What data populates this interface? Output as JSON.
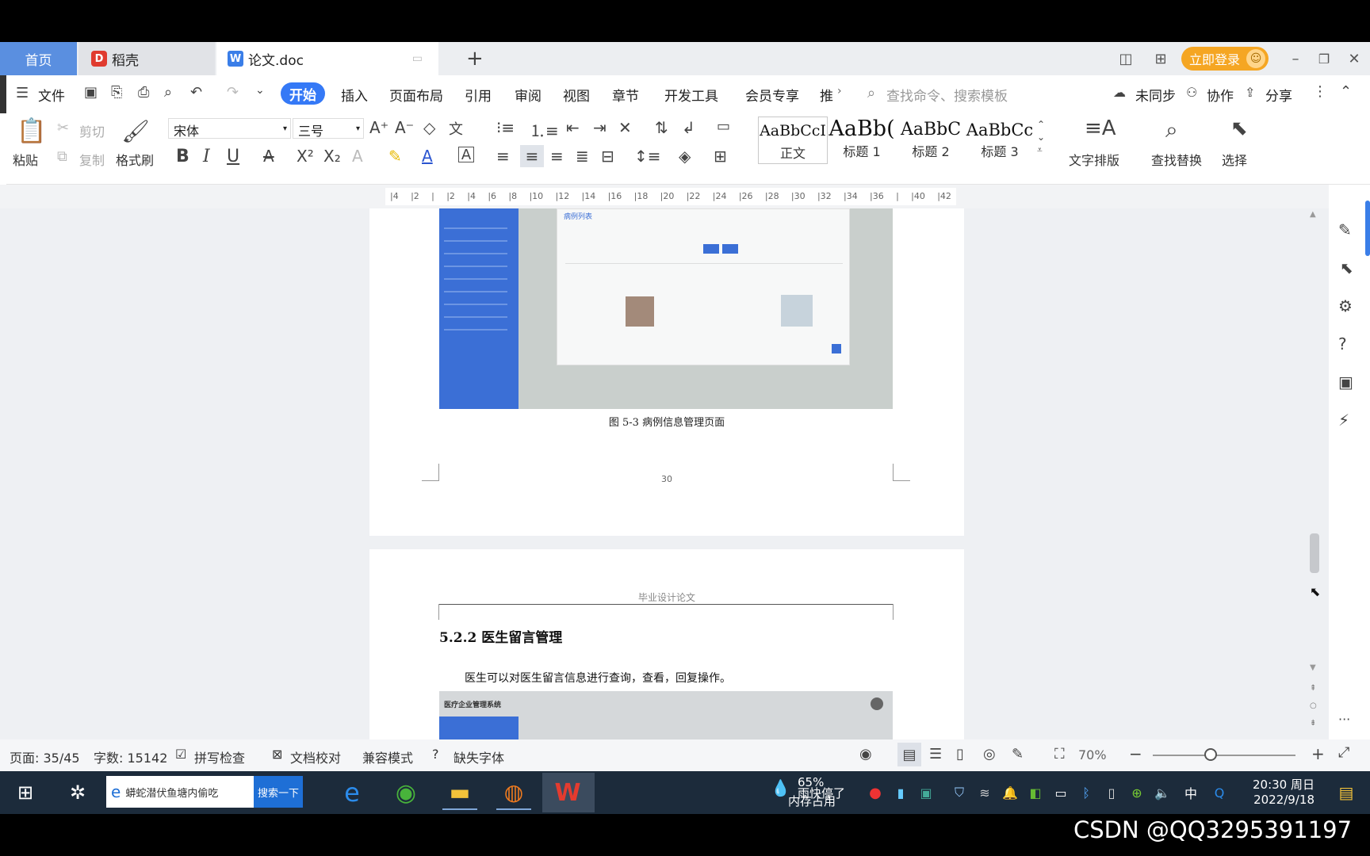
{
  "tabs": {
    "home": "首页",
    "daoke": "稻壳",
    "doc": "论文.doc",
    "new_tab": "+"
  },
  "titlebar": {
    "login": "立即登录"
  },
  "menu": {
    "file": "文件",
    "items": [
      "开始",
      "插入",
      "页面布局",
      "引用",
      "审阅",
      "视图",
      "章节",
      "开发工具",
      "会员专享",
      "推"
    ],
    "search_placeholder": "查找命令、搜索模板",
    "sync": "未同步",
    "collab": "协作",
    "share": "分享"
  },
  "ribbon": {
    "paste": "粘贴",
    "cut": "剪切",
    "copy": "复制",
    "format_painter": "格式刷",
    "font_name": "宋体",
    "font_size": "三号",
    "styles": [
      {
        "preview": "AaBbCcI",
        "label": "正文"
      },
      {
        "preview": "AaBb(",
        "label": "标题 1"
      },
      {
        "preview": "AaBbC",
        "label": "标题 2"
      },
      {
        "preview": "AaBbCc",
        "label": "标题 3"
      }
    ],
    "text_layout": "文字排版",
    "find_replace": "查找替换",
    "select": "选择"
  },
  "ruler": {
    "ticks": [
      "4",
      "2",
      "",
      "2",
      "4",
      "6",
      "8",
      "10",
      "12",
      "14",
      "16",
      "18",
      "20",
      "22",
      "24",
      "26",
      "28",
      "30",
      "32",
      "34",
      "36",
      "",
      "40",
      "42"
    ]
  },
  "document": {
    "figure1_inner_title": "病例列表",
    "figure_caption": "图 5-3 病例信息管理页面",
    "page_number": "30",
    "header_text": "毕业设计论文",
    "section_heading": "5.2.2 医生留言管理",
    "body_text": "医生可以对医生留言信息进行查询，查看，回复操作。",
    "figure2_title": "医疗企业管理系统"
  },
  "status": {
    "page": "页面: 35/45",
    "words": "字数: 15142",
    "spell": "拼写检查",
    "proof": "文档校对",
    "compat": "兼容模式",
    "missing_font": "缺失字体",
    "zoom": "70%"
  },
  "taskbar": {
    "search_text": "蟒蛇潜伏鱼塘内偷吃",
    "search_button": "搜索一下",
    "memory_percent": "65%",
    "memory_label": "内存占用",
    "rain": "雨快停了",
    "ime": "中",
    "time": "20:30 周日",
    "date": "2022/9/18"
  },
  "watermark": "CSDN @QQ3295391197"
}
